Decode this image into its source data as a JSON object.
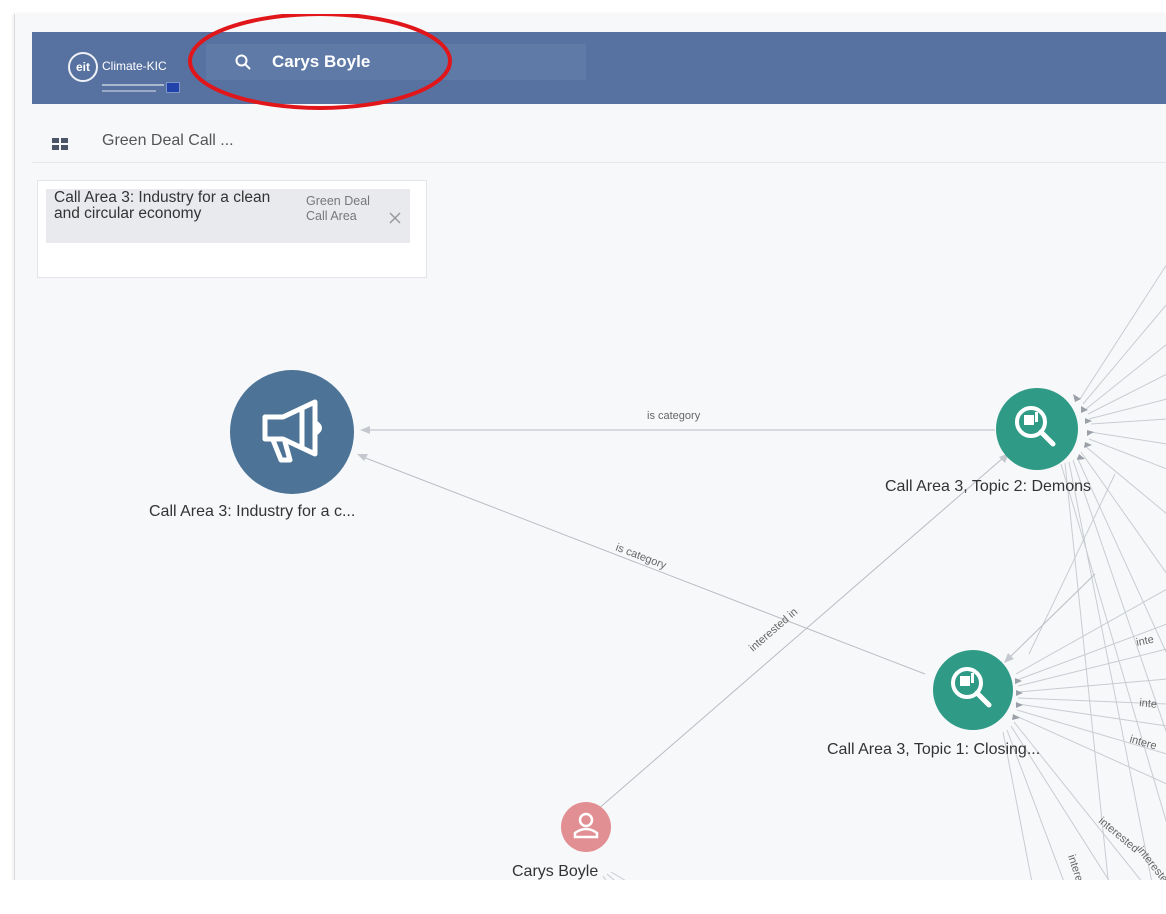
{
  "header": {
    "logo_text": "Climate-KIC",
    "logo_mark": "eit",
    "search_value": "Carys Boyle",
    "search_icon": "search-icon"
  },
  "subheader": {
    "breadcrumb": "Green Deal Call ..."
  },
  "filter": {
    "chip_label": "Call Area 3: Industry for a clean and circular economy",
    "chip_type": "Green Deal Call Area"
  },
  "graph": {
    "nodes": {
      "call_area": "Call Area 3: Industry for a c...",
      "topic2": "Call Area 3, Topic 2: Demons",
      "topic1": "Call Area 3, Topic 1: Closing...",
      "person": "Carys Boyle"
    },
    "edges": {
      "is_category_top": "is category",
      "is_category_mid": "is category",
      "interested_in": "interested in",
      "inte_1": "inte",
      "inte_2": "inte",
      "inte_3": "intere",
      "interested_a": "interested",
      "interested_b": "interested",
      "interested_c": "intereste"
    },
    "colors": {
      "call_area": "#4d7396",
      "topic": "#2f9a86",
      "person": "#e28f93"
    }
  }
}
